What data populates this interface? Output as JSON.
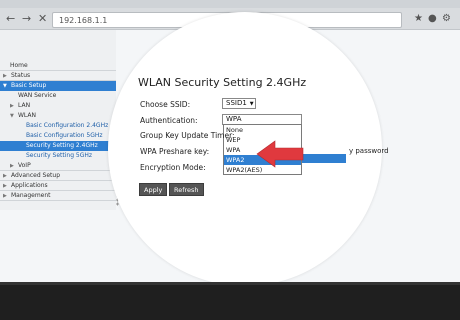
{
  "browser": {
    "url": "192.168.1.1",
    "back_icon": "arrow-left-icon",
    "forward_icon": "arrow-right-icon",
    "close_icon": "close-icon",
    "star_icon": "star-icon",
    "settings_icon": "gear-icon"
  },
  "sidebar": {
    "items": [
      {
        "label": "Home"
      },
      {
        "label": "Status"
      },
      {
        "label": "Basic Setup"
      },
      {
        "label": "WAN Service"
      },
      {
        "label": "LAN"
      },
      {
        "label": "WLAN"
      },
      {
        "label": "Basic Configuration 2.4GHz"
      },
      {
        "label": "Basic Configuration 5GHz"
      },
      {
        "label": "Security Setting 2.4GHz"
      },
      {
        "label": "Security Setting 5GHz"
      },
      {
        "label": "VoIP"
      },
      {
        "label": "Advanced Setup"
      },
      {
        "label": "Applications"
      },
      {
        "label": "Management"
      }
    ]
  },
  "main": {
    "title": "WLAN Security Setting 2.4GHz",
    "choose_ssid_label": "Choose SSID:",
    "ssid_value": "SSID1",
    "authentication_label": "Authentication:",
    "authentication_value": "WPA",
    "group_key_label": "Group Key Update Timer:",
    "wpa_preshare_label": "WPA Preshare key:",
    "encryption_label": "Encryption Mode:",
    "password_fragment": "y password",
    "auth_options": [
      "None",
      "WEP",
      "WPA",
      "WPA2",
      "WPA2(AES)"
    ],
    "highlighted_option": "WPA2",
    "apply_label": "Apply",
    "refresh_label": "Refresh"
  },
  "colors": {
    "highlight": "#2f7fd1",
    "pointer_arrow": "#e0393e"
  }
}
